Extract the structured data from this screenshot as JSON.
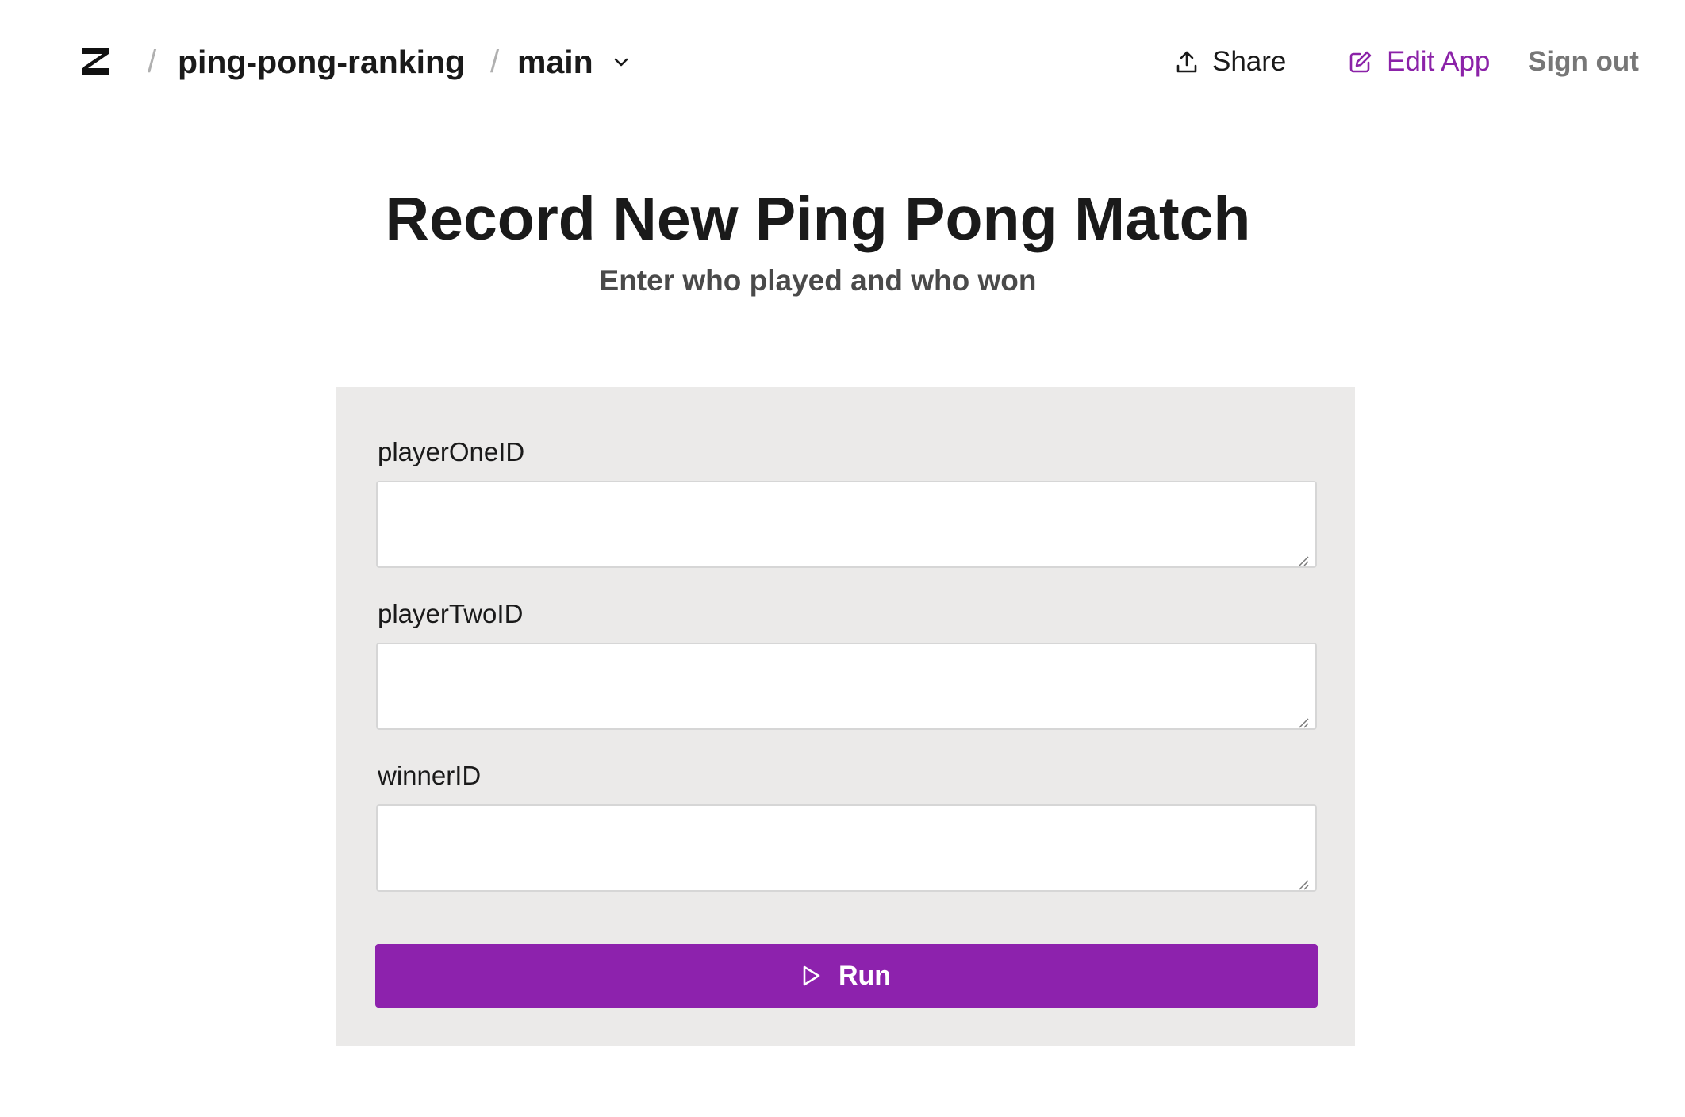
{
  "header": {
    "logo_icon": "app-logo-icon",
    "breadcrumb": {
      "separator": "/",
      "app_name": "ping-pong-ranking",
      "branch": "main"
    },
    "share_label": "Share",
    "edit_app_label": "Edit App",
    "sign_out_label": "Sign out"
  },
  "page": {
    "title": "Record New Ping Pong Match",
    "subtitle": "Enter who played and who won"
  },
  "form": {
    "fields": [
      {
        "label": "playerOneID",
        "value": ""
      },
      {
        "label": "playerTwoID",
        "value": ""
      },
      {
        "label": "winnerID",
        "value": ""
      }
    ],
    "run_label": "Run"
  },
  "colors": {
    "accent": "#8d22ad",
    "edit_link": "#8b22a8",
    "card_bg": "#ebeae9",
    "muted": "#777777"
  }
}
